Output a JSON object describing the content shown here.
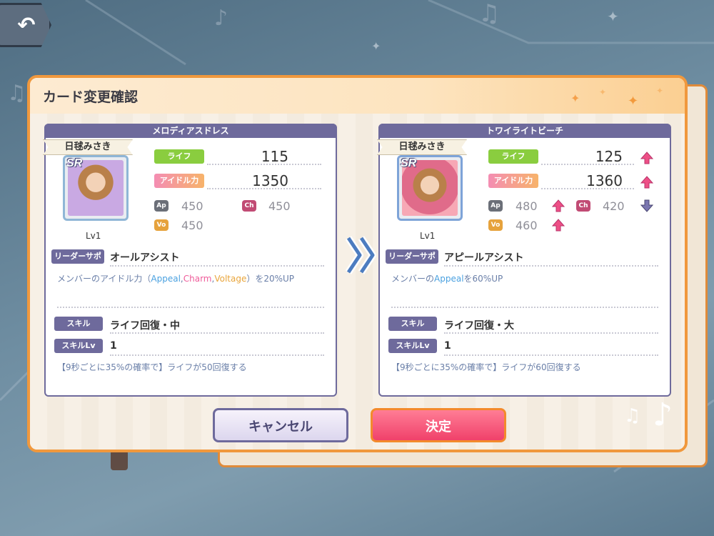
{
  "dialog": {
    "title": "カード変更確認"
  },
  "stat_labels": {
    "life": "ライフ",
    "idol_power": "アイドル力",
    "ap": "Ap",
    "ch": "Ch",
    "vo": "Vo"
  },
  "labels": {
    "leader_support": "リーダーサポート",
    "skill": "スキル",
    "skill_lv": "スキルLv"
  },
  "left_card": {
    "card_name": "メロディアスドレス",
    "character": "日毬みさき",
    "rarity": "SR",
    "level": "Lv1",
    "life": "115",
    "idol_power": "1350",
    "ap": "450",
    "ch": "450",
    "vo": "450",
    "leader_support_name": "オールアシスト",
    "leader_support_desc_prefix": "メンバーのアイドル力（",
    "leader_support_desc_appeal": "Appeal",
    "leader_support_desc_sep1": ",",
    "leader_support_desc_charm": "Charm",
    "leader_support_desc_sep2": ",",
    "leader_support_desc_voltage": "Voltage",
    "leader_support_desc_suffix": "）を20%UP",
    "skill_name": "ライフ回復・中",
    "skill_level": "1",
    "skill_desc": "【9秒ごとに35%の確率で】ライフが50回復する"
  },
  "right_card": {
    "card_name": "トワイライトビーチ",
    "character": "日毬みさき",
    "rarity": "SR",
    "level": "Lv1",
    "life": "125",
    "idol_power": "1360",
    "ap": "480",
    "ch": "420",
    "vo": "460",
    "leader_support_name": "アピールアシスト",
    "leader_support_desc_prefix": "メンバーの",
    "leader_support_desc_appeal": "Appeal",
    "leader_support_desc_suffix": "を60%UP",
    "skill_name": "ライフ回復・大",
    "skill_level": "1",
    "skill_desc": "【9秒ごとに35%の確率で】ライフが60回復する",
    "changes": {
      "life": "up",
      "idol_power": "up",
      "ap": "up",
      "ch": "down",
      "vo": "up"
    }
  },
  "buttons": {
    "cancel": "キャンセル",
    "confirm": "決定"
  },
  "colors": {
    "accent_orange": "#f0983d",
    "card_border": "#6e6a9c",
    "up_arrow": "#ee4f86",
    "down_arrow": "#6e6a9c"
  }
}
